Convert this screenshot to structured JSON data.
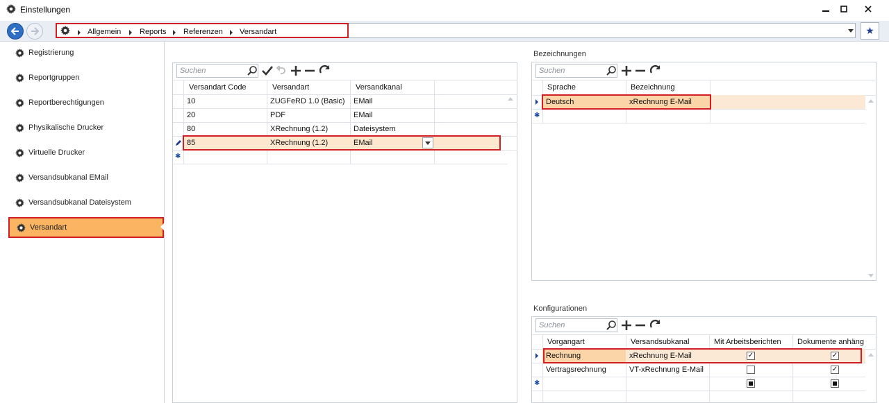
{
  "window": {
    "title": "Einstellungen"
  },
  "breadcrumb": [
    "Allgemein",
    "Reports",
    "Referenzen",
    "Versandart"
  ],
  "sidebar": {
    "items": [
      {
        "label": "Registrierung",
        "selected": false
      },
      {
        "label": "Reportgruppen",
        "selected": false
      },
      {
        "label": "Reportberechtigungen",
        "selected": false
      },
      {
        "label": "Physikalische Drucker",
        "selected": false
      },
      {
        "label": "Virtuelle Drucker",
        "selected": false
      },
      {
        "label": "Versandsubkanal EMail",
        "selected": false
      },
      {
        "label": "Versandsubkanal Dateisystem",
        "selected": false
      },
      {
        "label": "Versandart",
        "selected": true
      }
    ]
  },
  "main_grid": {
    "search_placeholder": "Suchen",
    "columns": [
      "Versandart Code",
      "Versandart",
      "Versandkanal"
    ],
    "rows": [
      [
        "10",
        "ZUGFeRD 1.0 (Basic)",
        "EMail"
      ],
      [
        "20",
        "PDF",
        "EMail"
      ],
      [
        "80",
        "XRechnung (1.2)",
        "Dateisystem"
      ],
      [
        "85",
        "XRechnung (1.2)",
        "EMail"
      ]
    ]
  },
  "bezeichnungen": {
    "title": "Bezeichnungen",
    "search_placeholder": "Suchen",
    "columns": [
      "Sprache",
      "Bezeichnung"
    ],
    "rows": [
      [
        "Deutsch",
        "xRechnung E-Mail"
      ]
    ]
  },
  "konfigurationen": {
    "title": "Konfigurationen",
    "search_placeholder": "Suchen",
    "columns": [
      "Vorgangart",
      "Versandsubkanal",
      "Mit Arbeitsberichten",
      "Dokumente anhäng"
    ],
    "rows": [
      {
        "vorgangart": "Rechnung",
        "subkanal": "xRechnung E-Mail",
        "mit_arbeitsberichten": true,
        "dokumente": true
      },
      {
        "vorgangart": "Vertragsrechnung",
        "subkanal": "VT-xRechnung E-Mail",
        "mit_arbeitsberichten": false,
        "dokumente": true
      }
    ]
  },
  "colors": {
    "accent_orange": "#fbb462",
    "highlight_red": "#d21f26",
    "selected_row": "#fbe9d6",
    "nav_blue": "#2e6fc4"
  }
}
